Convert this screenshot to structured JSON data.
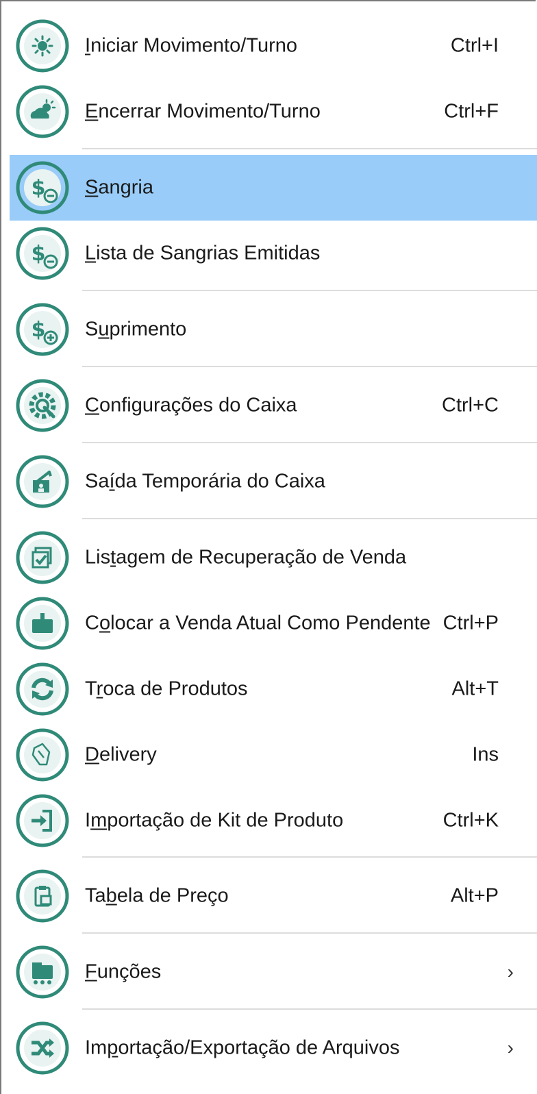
{
  "colors": {
    "icon": "#2f8a78",
    "highlight": "#99ccf8",
    "text": "#1a1a1a",
    "separator": "#dcdcdc"
  },
  "items": [
    {
      "pre": "",
      "key": "I",
      "post": "niciar Movimento/Turno",
      "shortcut": "Ctrl+I",
      "icon": "sun-icon"
    },
    {
      "pre": "",
      "key": "E",
      "post": "ncerrar Movimento/Turno",
      "shortcut": "Ctrl+F",
      "icon": "cloud-sun-icon"
    },
    {
      "pre": "",
      "key": "S",
      "post": "angria",
      "shortcut": "",
      "icon": "money-minus-icon"
    },
    {
      "pre": "",
      "key": "L",
      "post": "ista de Sangrias Emitidas",
      "shortcut": "",
      "icon": "money-minus-list-icon"
    },
    {
      "pre": "S",
      "key": "u",
      "post": "primento",
      "shortcut": "",
      "icon": "money-plus-icon"
    },
    {
      "pre": "",
      "key": "C",
      "post": "onfigurações do Caixa",
      "shortcut": "Ctrl+C",
      "icon": "gear-wrench-icon"
    },
    {
      "pre": "Sa",
      "key": "í",
      "post": "da Temporária do Caixa",
      "shortcut": "",
      "icon": "exit-register-icon"
    },
    {
      "pre": "Lis",
      "key": "t",
      "post": "agem de Recuperação de Venda",
      "shortcut": "",
      "icon": "recover-sale-icon"
    },
    {
      "pre": "C",
      "key": "o",
      "post": "locar a Venda Atual Como Pendente",
      "shortcut": "Ctrl+P",
      "icon": "pending-sale-icon"
    },
    {
      "pre": "T",
      "key": "r",
      "post": "oca de Produtos",
      "shortcut": "Alt+T",
      "icon": "exchange-icon"
    },
    {
      "pre": "",
      "key": "D",
      "post": "elivery",
      "shortcut": "Ins",
      "icon": "delivery-icon"
    },
    {
      "pre": "I",
      "key": "m",
      "post": "portação de Kit de Produto",
      "shortcut": "Ctrl+K",
      "icon": "import-icon"
    },
    {
      "pre": "Ta",
      "key": "b",
      "post": "ela de Preço",
      "shortcut": "Alt+P",
      "icon": "price-table-icon"
    },
    {
      "pre": "",
      "key": "F",
      "post": "unções",
      "shortcut": "",
      "icon": "functions-cart-icon",
      "arrow": "›"
    },
    {
      "pre": "Im",
      "key": "p",
      "post": "ortação/Exportação de Arquivos",
      "shortcut": "",
      "icon": "shuffle-icon",
      "arrow": "›"
    }
  ]
}
